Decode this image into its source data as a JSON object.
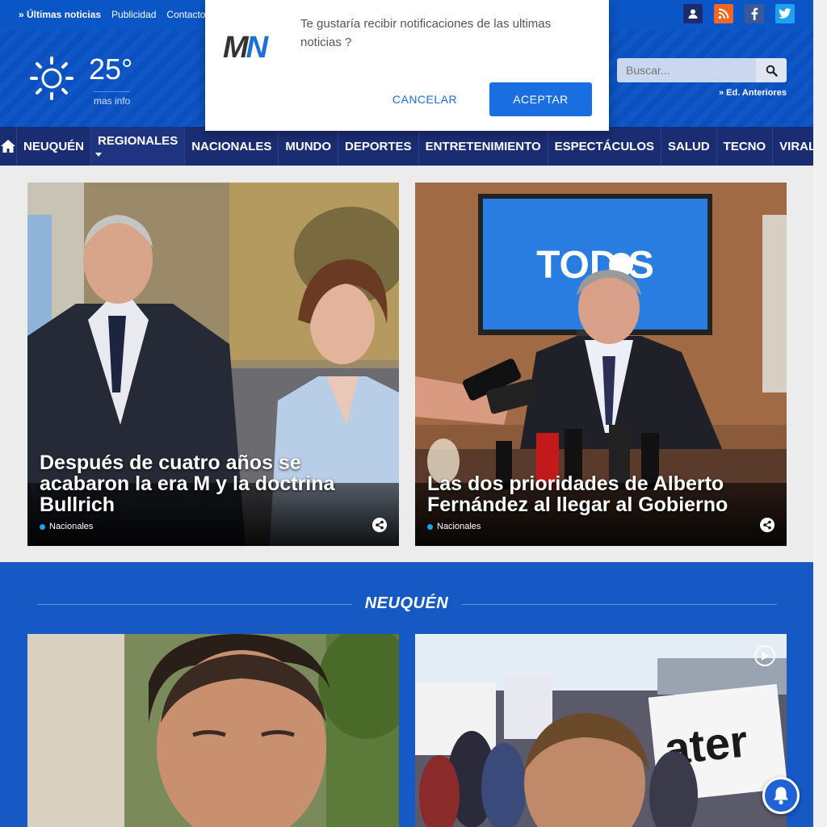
{
  "topbar": {
    "latest_label": "» Últimas noticias",
    "links": [
      "Publicidad",
      "Contacto"
    ],
    "social_icons": [
      "user-icon",
      "rss-icon",
      "facebook-icon",
      "twitter-icon"
    ]
  },
  "weather": {
    "temperature": "25°",
    "more_label": "mas info",
    "icon": "sun-icon"
  },
  "search": {
    "placeholder": "Buscar...",
    "icon": "search-icon"
  },
  "editions_label": "» Ed. Anteriores",
  "nav": {
    "items": [
      "NEUQUÉN",
      "REGIONALES",
      "NACIONALES",
      "MUNDO",
      "DEPORTES",
      "ENTRETENIMIENTO",
      "ESPECTÁCULOS",
      "SALUD",
      "TECNO",
      "VIRAL"
    ]
  },
  "hero": [
    {
      "headline": "Después de cuatro años se acabaron la era M y la doctrina Bullrich",
      "category": "Nacionales"
    },
    {
      "headline": "Las dos prioridades de Alberto Fernández al llegar al Gobierno",
      "category": "Nacionales"
    }
  ],
  "section": {
    "title": "NEUQUÉN"
  },
  "dialog": {
    "logo": "MN",
    "message": "Te gustaría recibir notificaciones de las ultimas noticias ?",
    "cancel_label": "CANCELAR",
    "accept_label": "ACEPTAR"
  },
  "colors": {
    "brand_blue": "#0b56c7",
    "nav_navy": "#1a2d73",
    "accent": "#1a6fe0"
  }
}
